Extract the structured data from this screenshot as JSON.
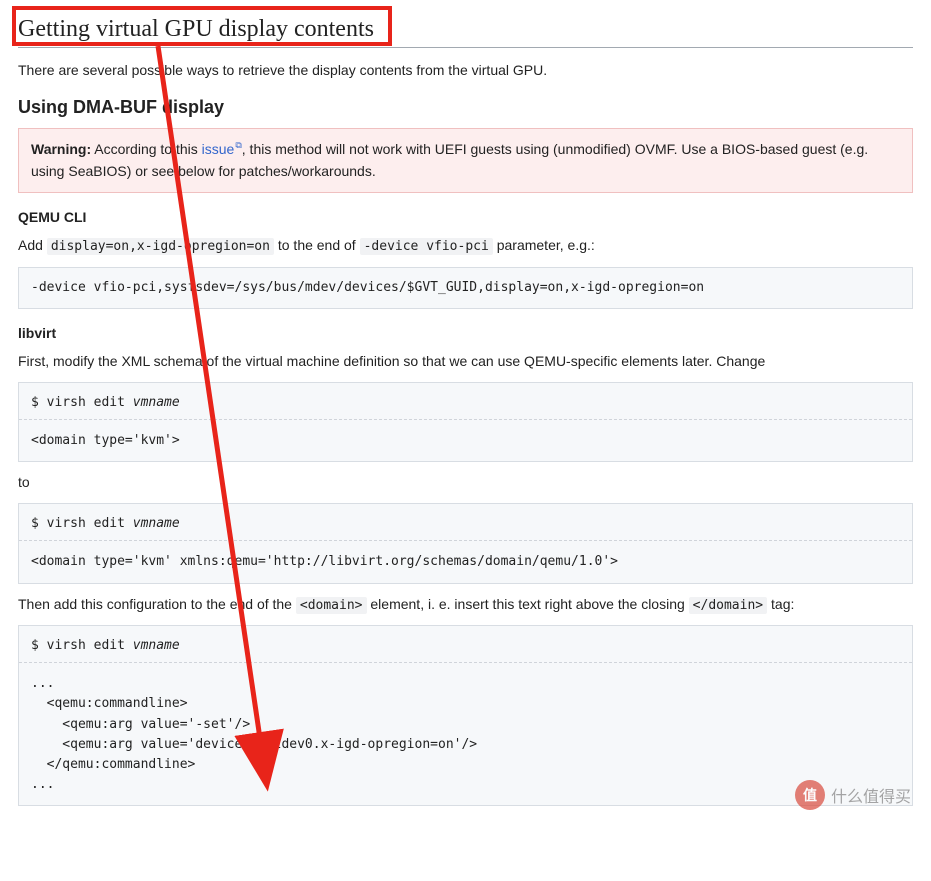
{
  "heading": "Getting virtual GPU display contents",
  "intro": "There are several possible ways to retrieve the display contents from the virtual GPU.",
  "dmabuf": {
    "heading": "Using DMA-BUF display",
    "warning_label": "Warning:",
    "warning_pre": " According to this ",
    "warning_link": "issue",
    "warning_post": ", this method will not work with UEFI guests using (unmodified) OVMF. Use a BIOS-based guest (e.g. using SeaBIOS) or see below for patches/workarounds."
  },
  "qemu": {
    "heading": "QEMU CLI",
    "add_pre": "Add ",
    "code1": "display=on,x-igd-opregion=on",
    "add_mid": " to the end of ",
    "code2": "-device vfio-pci",
    "add_post": " parameter, e.g.:",
    "block": "-device vfio-pci,sysfsdev=/sys/bus/mdev/devices/$GVT_GUID,display=on,x-igd-opregion=on"
  },
  "libvirt": {
    "heading": "libvirt",
    "para1": "First, modify the XML schema of the virtual machine definition so that we can use QEMU-specific elements later. Change",
    "block1_cmd": "$ virsh edit ",
    "block1_cmd_it": "vmname",
    "block1_body": "<domain type='kvm'>",
    "to": "to",
    "block2_cmd": "$ virsh edit ",
    "block2_cmd_it": "vmname",
    "block2_body": "<domain type='kvm' xmlns:qemu='http://libvirt.org/schemas/domain/qemu/1.0'>",
    "para2_pre": "Then add this configuration to the end of the ",
    "para2_code1": "<domain>",
    "para2_mid": " element, i. e. insert this text right above the closing ",
    "para2_code2": "</domain>",
    "para2_post": " tag:",
    "block3_cmd": "$ virsh edit ",
    "block3_cmd_it": "vmname",
    "block3_body": "...\n  <qemu:commandline>\n    <qemu:arg value='-set'/>\n    <qemu:arg value='device.hostdev0.x-igd-opregion=on'/>\n  </qemu:commandline>\n..."
  },
  "watermark": {
    "badge": "值",
    "text": "什么值得买"
  },
  "annotation": {
    "color": "#e8241a"
  }
}
